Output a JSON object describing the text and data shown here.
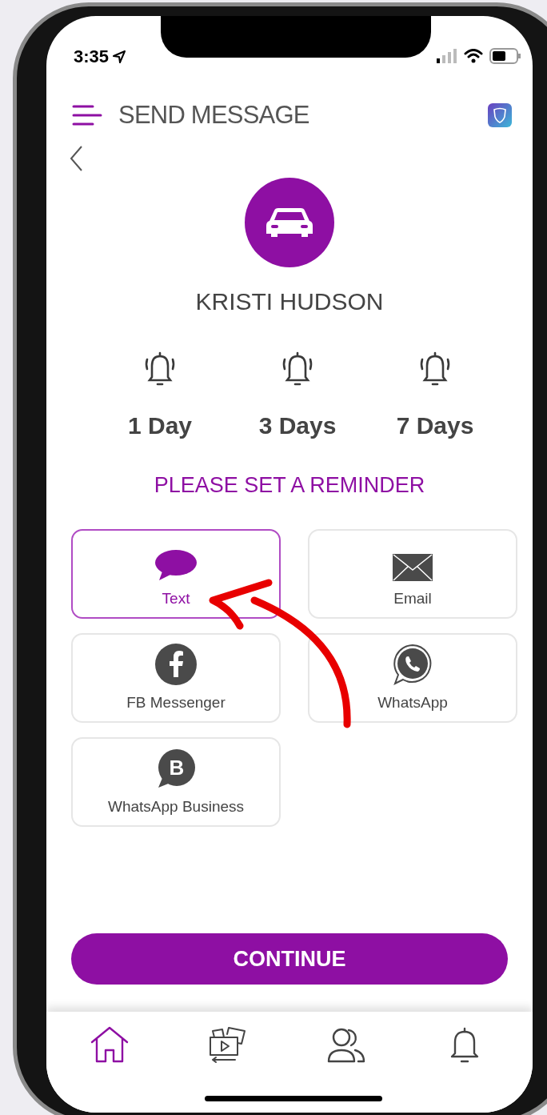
{
  "status_bar": {
    "time": "3:35"
  },
  "header": {
    "title": "SEND MESSAGE"
  },
  "contact": {
    "name": "KRISTI HUDSON"
  },
  "reminders": [
    {
      "label": "1 Day"
    },
    {
      "label": "3 Days"
    },
    {
      "label": "7 Days"
    }
  ],
  "reminder_prompt": "PLEASE SET A REMINDER",
  "channels": [
    {
      "kind": "text",
      "label": "Text",
      "selected": true
    },
    {
      "kind": "email",
      "label": "Email",
      "selected": false
    },
    {
      "kind": "facebook",
      "label": "FB Messenger",
      "selected": false
    },
    {
      "kind": "whatsapp",
      "label": "WhatsApp",
      "selected": false
    },
    {
      "kind": "business",
      "label": "WhatsApp Business",
      "icon_letter": "B",
      "selected": false
    }
  ],
  "continue_button": "CONTINUE",
  "nav": [
    {
      "kind": "home",
      "selected": true
    },
    {
      "kind": "media",
      "selected": false
    },
    {
      "kind": "contacts",
      "selected": false
    },
    {
      "kind": "notifications",
      "selected": false
    }
  ]
}
